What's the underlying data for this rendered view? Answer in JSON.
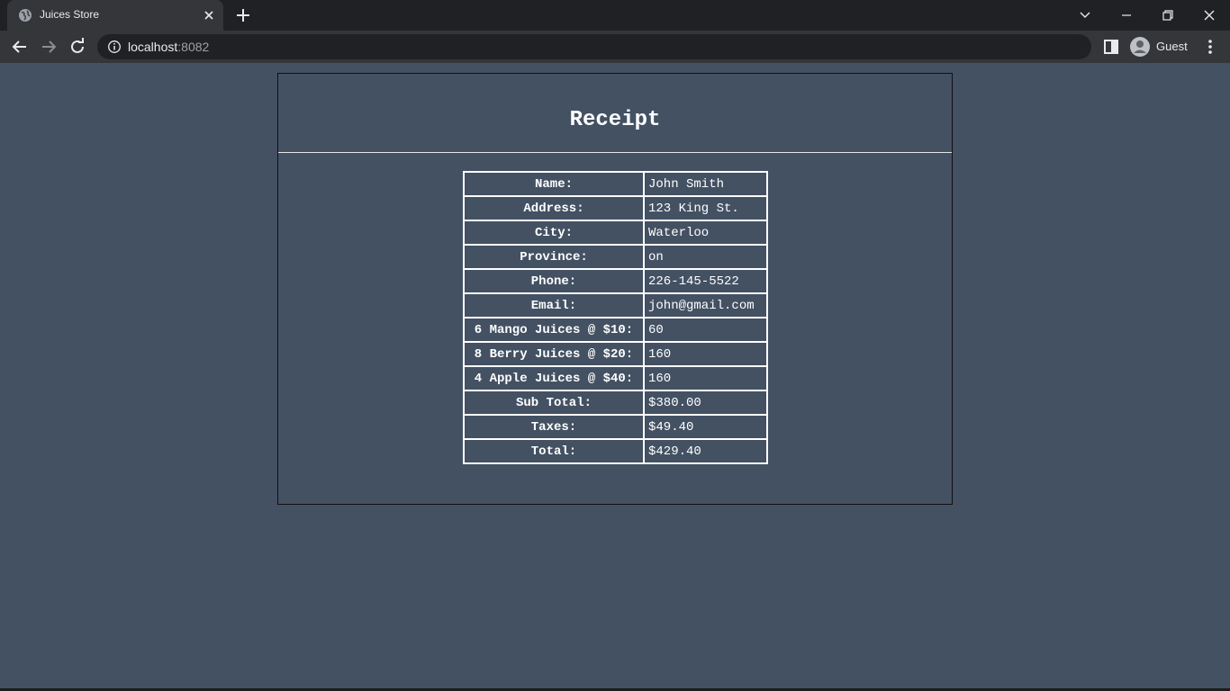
{
  "browser": {
    "tab_title": "Juices Store",
    "url_host": "localhost",
    "url_port": ":8082",
    "profile_label": "Guest",
    "icons": [
      "globe-icon",
      "close-icon",
      "plus-icon",
      "chevron-down-icon",
      "minimize-icon",
      "restore-icon",
      "close-window-icon",
      "back-icon",
      "forward-icon",
      "reload-icon",
      "info-icon",
      "side-panel-icon",
      "avatar-icon",
      "kebab-menu-icon"
    ]
  },
  "page": {
    "title": "Receipt",
    "background_color": "#435163",
    "rows": [
      {
        "label": "Name:",
        "value": "John Smith"
      },
      {
        "label": "Address:",
        "value": "123 King St."
      },
      {
        "label": "City:",
        "value": "Waterloo"
      },
      {
        "label": "Province:",
        "value": "on"
      },
      {
        "label": "Phone:",
        "value": "226-145-5522"
      },
      {
        "label": "Email:",
        "value": "john@gmail.com"
      },
      {
        "label": "6 Mango Juices @ $10:",
        "value": "60"
      },
      {
        "label": "8 Berry Juices @ $20:",
        "value": "160"
      },
      {
        "label": "4 Apple Juices @ $40:",
        "value": "160"
      },
      {
        "label": "Sub Total:",
        "value": "$380.00"
      },
      {
        "label": "Taxes:",
        "value": "$49.40"
      },
      {
        "label": "Total:",
        "value": "$429.40"
      }
    ]
  }
}
